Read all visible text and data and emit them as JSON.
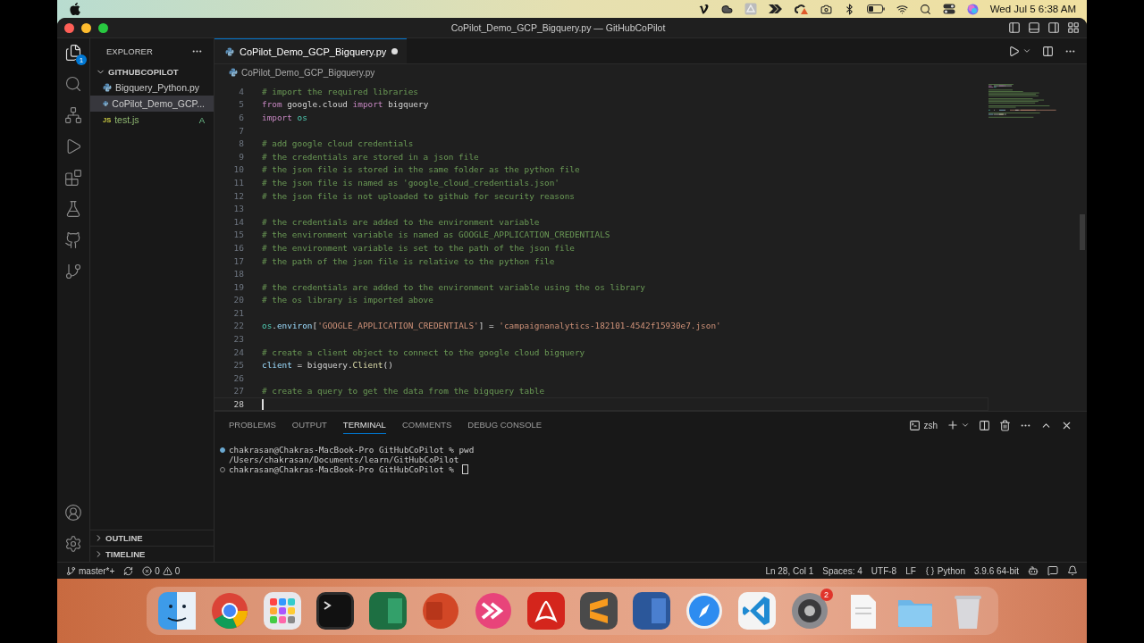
{
  "menu_bar": {
    "clock": "Wed Jul 5  6:38 AM"
  },
  "window": {
    "title": "CoPilot_Demo_GCP_Bigquery.py — GitHubCoPilot"
  },
  "activity_bar": {
    "explorer_badge": "1"
  },
  "sidebar": {
    "title": "EXPLORER",
    "folder": "GITHUBCOPILOT",
    "files": [
      {
        "name": "Bigquery_Python.py",
        "kind": "python",
        "selected": false
      },
      {
        "name": "CoPilot_Demo_GCP...",
        "kind": "python",
        "selected": true
      },
      {
        "name": "test.js",
        "kind": "js",
        "icon_text": "JS",
        "badge": "A",
        "selected": false
      }
    ],
    "sections": [
      {
        "label": "OUTLINE",
        "expanded": false
      },
      {
        "label": "TIMELINE",
        "expanded": false
      }
    ]
  },
  "editor": {
    "tabs": [
      {
        "label": "CoPilot_Demo_GCP_Bigquery.py",
        "selected": true,
        "modified": true
      }
    ],
    "breadcrumb": "CoPilot_Demo_GCP_Bigquery.py",
    "lines": [
      {
        "num": "4",
        "current": false,
        "tokens": [
          {
            "kind": "comment",
            "text": "# import the required libraries"
          }
        ]
      },
      {
        "num": "5",
        "current": false,
        "tokens": [
          {
            "kind": "keyword",
            "text": "from"
          },
          {
            "kind": "plain",
            "text": " google.cloud "
          },
          {
            "kind": "keyword",
            "text": "import"
          },
          {
            "kind": "plain",
            "text": " bigquery"
          }
        ]
      },
      {
        "num": "6",
        "current": false,
        "tokens": [
          {
            "kind": "keyword",
            "text": "import"
          },
          {
            "kind": "module",
            "text": " os"
          }
        ]
      },
      {
        "num": "7",
        "current": false
      },
      {
        "num": "8",
        "current": false,
        "tokens": [
          {
            "kind": "comment",
            "text": "# add google cloud credentials"
          }
        ]
      },
      {
        "num": "9",
        "current": false,
        "tokens": [
          {
            "kind": "comment",
            "text": "# the credentials are stored in a json file"
          }
        ]
      },
      {
        "num": "10",
        "current": false,
        "tokens": [
          {
            "kind": "comment",
            "text": "# the json file is stored in the same folder as the python file"
          }
        ]
      },
      {
        "num": "11",
        "current": false,
        "tokens": [
          {
            "kind": "comment",
            "text": "# the json file is named as 'google_cloud_credentials.json'"
          }
        ]
      },
      {
        "num": "12",
        "current": false,
        "tokens": [
          {
            "kind": "comment",
            "text": "# the json file is not uploaded to github for security reasons"
          }
        ]
      },
      {
        "num": "13",
        "current": false
      },
      {
        "num": "14",
        "current": false,
        "tokens": [
          {
            "kind": "comment",
            "text": "# the credentials are added to the environment variable"
          }
        ]
      },
      {
        "num": "15",
        "current": false,
        "tokens": [
          {
            "kind": "comment",
            "text": "# the environment variable is named as GOOGLE_APPLICATION_CREDENTIALS"
          }
        ]
      },
      {
        "num": "16",
        "current": false,
        "tokens": [
          {
            "kind": "comment",
            "text": "# the environment variable is set to the path of the json file"
          }
        ]
      },
      {
        "num": "17",
        "current": false,
        "tokens": [
          {
            "kind": "comment",
            "text": "# the path of the json file is relative to the python file"
          }
        ]
      },
      {
        "num": "18",
        "current": false
      },
      {
        "num": "19",
        "current": false,
        "tokens": [
          {
            "kind": "comment",
            "text": "# the credentials are added to the environment variable using the os library"
          }
        ]
      },
      {
        "num": "20",
        "current": false,
        "tokens": [
          {
            "kind": "comment",
            "text": "# the os library is imported above"
          }
        ]
      },
      {
        "num": "21",
        "current": false
      },
      {
        "num": "22",
        "current": false,
        "tokens": [
          {
            "kind": "module",
            "text": "os"
          },
          {
            "kind": "plain",
            "text": "."
          },
          {
            "kind": "var",
            "text": "environ"
          },
          {
            "kind": "plain",
            "text": "["
          },
          {
            "kind": "string",
            "text": "'GOOGLE_APPLICATION_CREDENTIALS'"
          },
          {
            "kind": "plain",
            "text": "] = "
          },
          {
            "kind": "string",
            "text": "'campaignanalytics-182101-4542f15930e7.json'"
          }
        ]
      },
      {
        "num": "23",
        "current": false
      },
      {
        "num": "24",
        "current": false,
        "tokens": [
          {
            "kind": "comment",
            "text": "# create a client object to connect to the google cloud bigquery"
          }
        ]
      },
      {
        "num": "25",
        "current": false,
        "tokens": [
          {
            "kind": "var",
            "text": "client"
          },
          {
            "kind": "plain",
            "text": " = bigquery."
          },
          {
            "kind": "func",
            "text": "Client"
          },
          {
            "kind": "plain",
            "text": "()"
          }
        ]
      },
      {
        "num": "26",
        "current": false
      },
      {
        "num": "27",
        "current": false,
        "tokens": [
          {
            "kind": "comment",
            "text": "# create a query to get the data from the bigquery table"
          }
        ]
      },
      {
        "num": "28",
        "current": true
      }
    ]
  },
  "panel": {
    "tabs": [
      {
        "label": "PROBLEMS",
        "selected": false
      },
      {
        "label": "OUTPUT",
        "selected": false
      },
      {
        "label": "TERMINAL",
        "selected": true
      },
      {
        "label": "COMMENTS",
        "selected": false
      },
      {
        "label": "DEBUG CONSOLE",
        "selected": false
      }
    ],
    "shell": "zsh",
    "terminal": [
      {
        "kind": "command",
        "done": true,
        "text": "chakrasan@Chakras-MacBook-Pro GitHubCoPilot % pwd"
      },
      {
        "kind": "output",
        "text": "/Users/chakrasan/Documents/learn/GitHubCoPilot"
      },
      {
        "kind": "command",
        "done": false,
        "text": "chakrasan@Chakras-MacBook-Pro GitHubCoPilot % "
      }
    ]
  },
  "status_bar": {
    "branch": "master*+",
    "errors": "0",
    "warnings": "0",
    "position": "Ln 28, Col 1",
    "indent": "Spaces: 4",
    "encoding": "UTF-8",
    "eol": "LF",
    "language": "Python",
    "interpreter": "3.9.6 64-bit"
  },
  "dock": [
    {
      "kind": "finder"
    },
    {
      "kind": "chrome"
    },
    {
      "kind": "launchpad"
    },
    {
      "kind": "terminal"
    },
    {
      "kind": "excel"
    },
    {
      "kind": "powerpoint"
    },
    {
      "kind": "arrows"
    },
    {
      "kind": "acrobat"
    },
    {
      "kind": "sublime"
    },
    {
      "kind": "word"
    },
    {
      "kind": "safari"
    },
    {
      "kind": "vscode"
    },
    {
      "kind": "settings",
      "badge": "2"
    },
    {
      "kind": "document"
    },
    {
      "kind": "folder"
    },
    {
      "kind": "trash"
    }
  ]
}
